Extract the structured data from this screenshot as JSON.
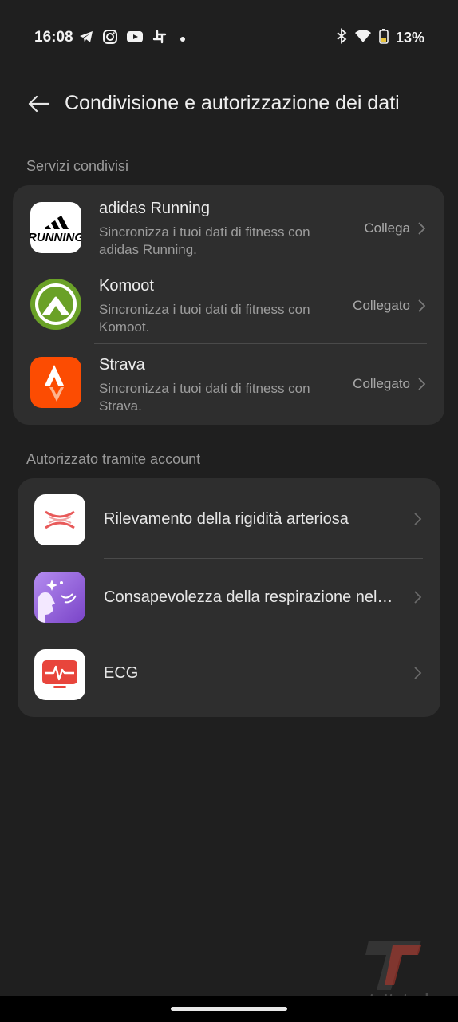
{
  "status_bar": {
    "time": "16:08",
    "battery": "13%",
    "left_icons": [
      "telegram-icon",
      "instagram-icon",
      "youtube-icon",
      "slack-icon",
      "notification-dot"
    ],
    "right_icons": [
      "bluetooth-icon",
      "wifi-icon",
      "battery-icon"
    ]
  },
  "header": {
    "title": "Condivisione e autorizzazione dei dati",
    "back_icon": "back-arrow-icon"
  },
  "shared_services": {
    "label": "Servizi condivisi",
    "items": [
      {
        "title": "adidas Running",
        "subtitle": "Sincronizza i tuoi dati di fitness con adidas Running.",
        "status": "Collega",
        "icon": "adidas-running-icon"
      },
      {
        "title": "Komoot",
        "subtitle": "Sincronizza i tuoi dati di fitness con Komoot.",
        "status": "Collegato",
        "icon": "komoot-icon"
      },
      {
        "title": "Strava",
        "subtitle": "Sincronizza i tuoi dati di fitness con Strava.",
        "status": "Collegato",
        "icon": "strava-icon"
      }
    ]
  },
  "account_authorized": {
    "label": "Autorizzato tramite account",
    "items": [
      {
        "title": "Rilevamento della rigidità arteriosa",
        "icon": "arterial-stiffness-icon"
      },
      {
        "title": "Consapevolezza della respirazione nel…",
        "icon": "breathing-awareness-icon"
      },
      {
        "title": "ECG",
        "icon": "ecg-icon"
      }
    ]
  },
  "adidas_logo_text": "RUNNING",
  "watermark_text": "tuttotech",
  "colors": {
    "background": "#1f1f1f",
    "card": "#2e2e2e",
    "strava": "#fc4c02",
    "komoot": "#6aa127",
    "breathing": "#8b5fd6",
    "ecg": "#e8453c"
  }
}
